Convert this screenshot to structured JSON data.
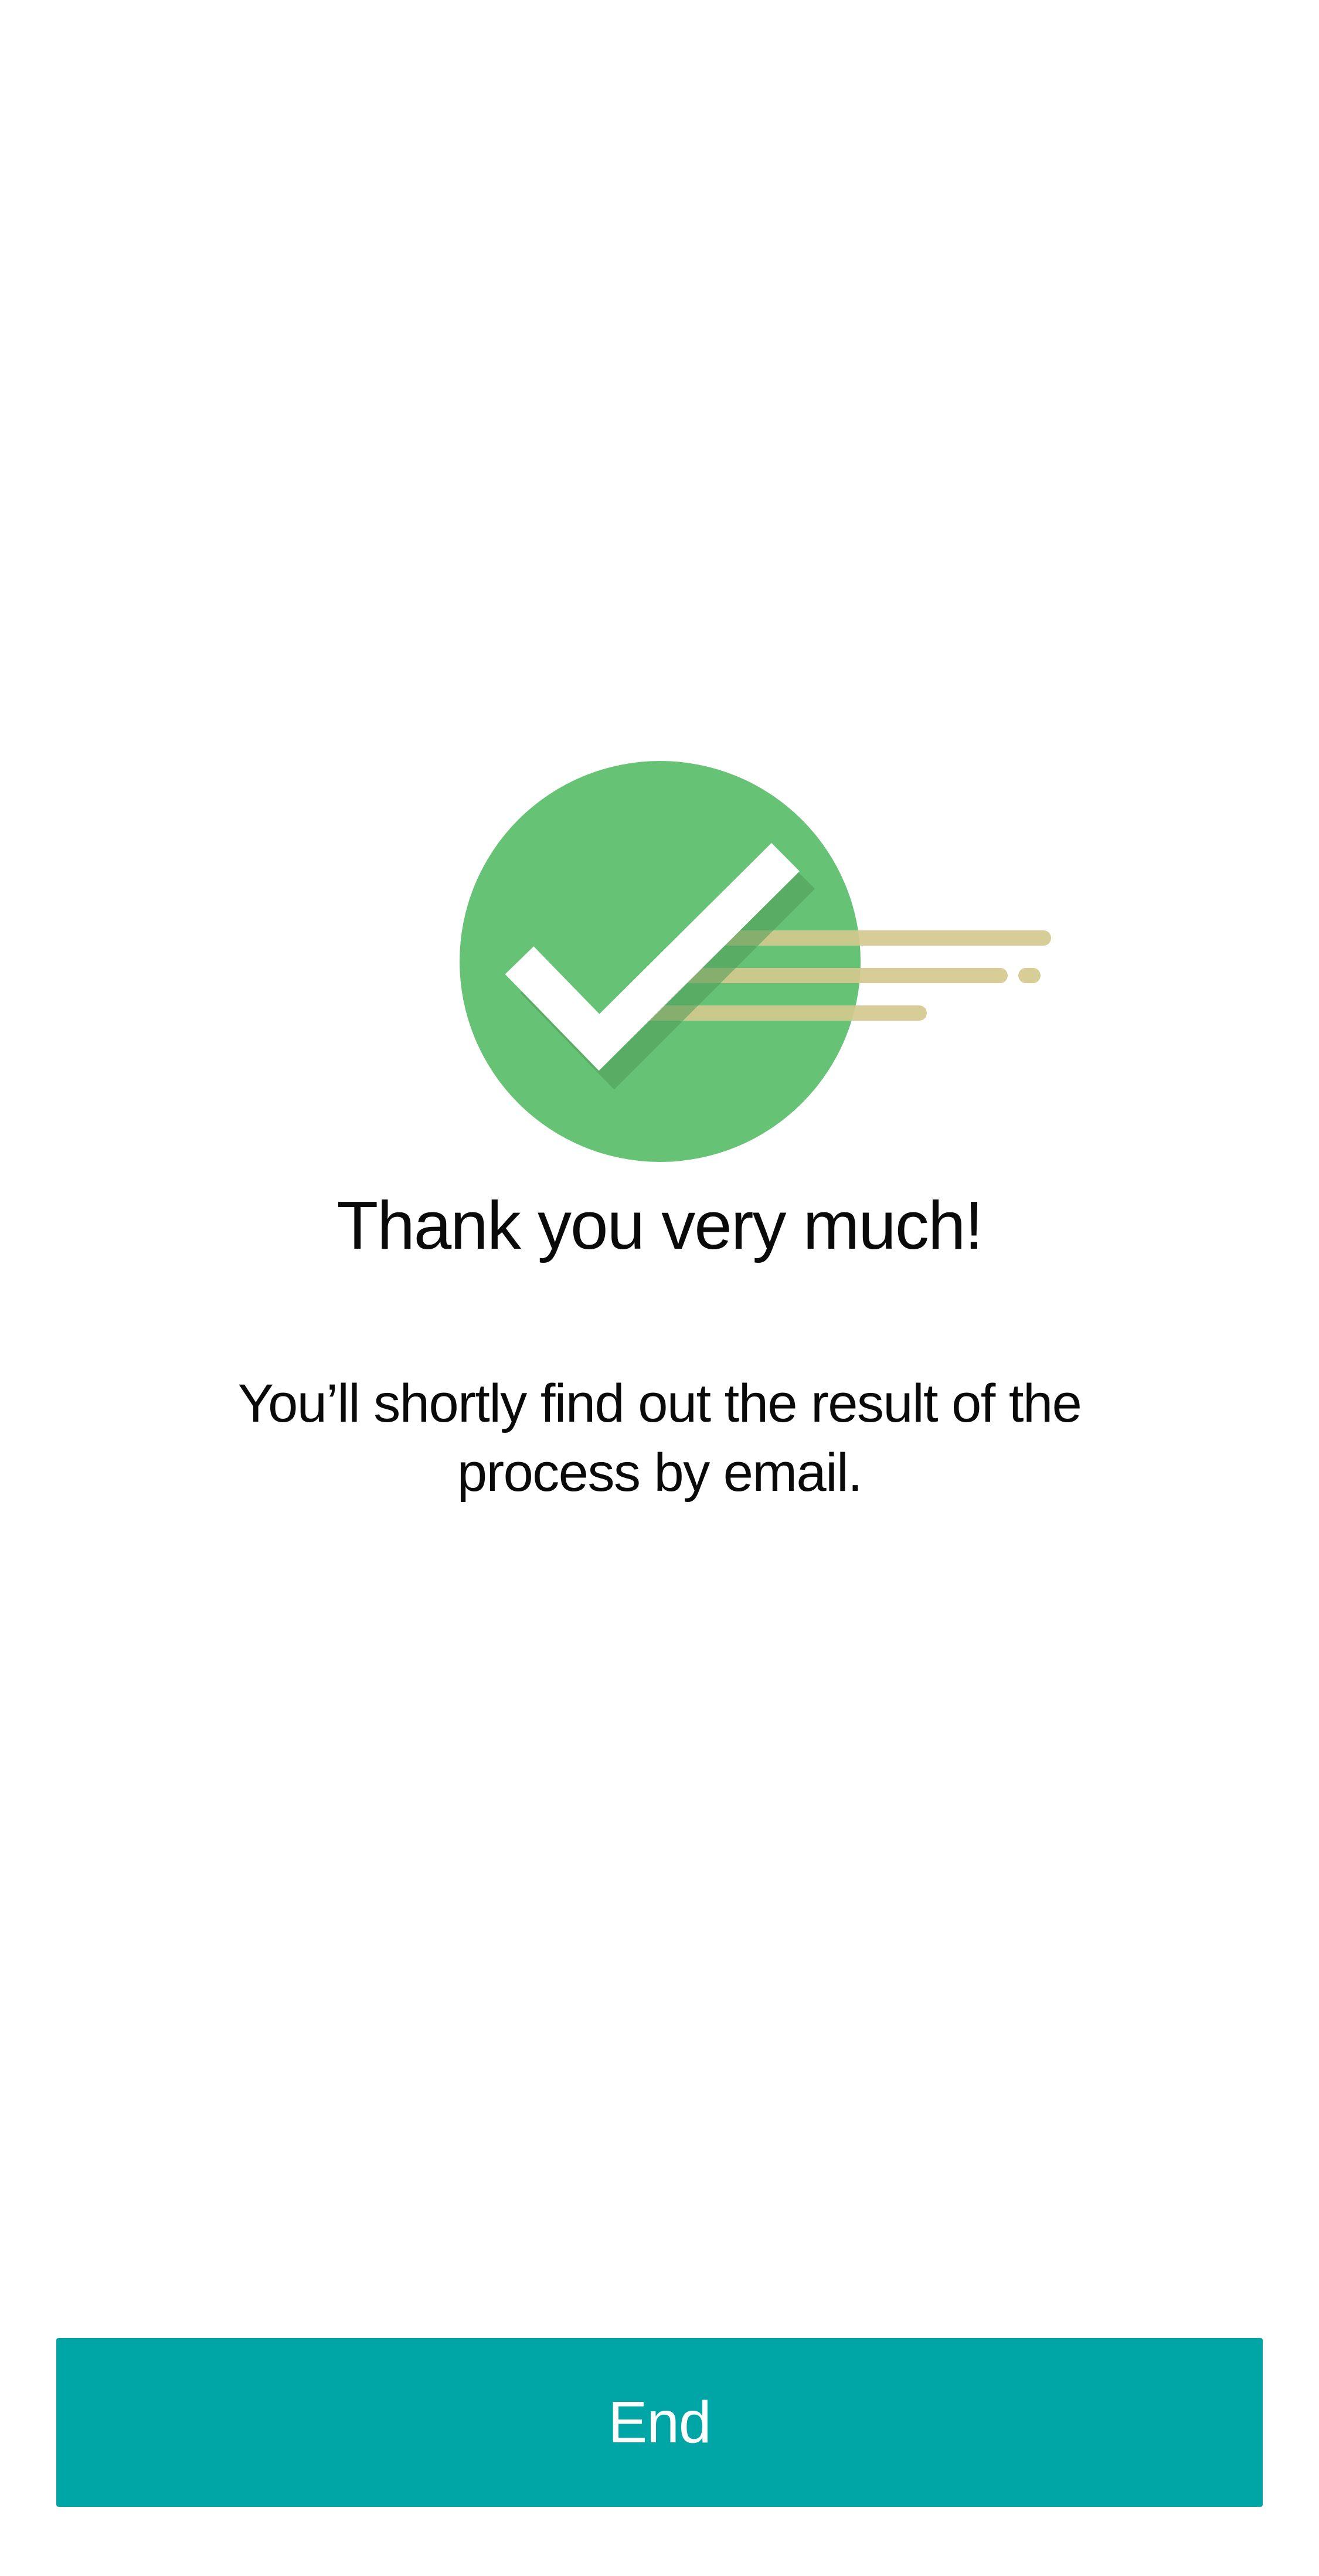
{
  "confirmation": {
    "icon": "success-check-icon",
    "title": "Thank you very much!",
    "message": "You’ll shortly find out the result of the process by email."
  },
  "actions": {
    "end_label": "End"
  },
  "colors": {
    "success_green": "#66c274",
    "speed_lines": "#d4c98f",
    "button_teal": "#00a6a6",
    "text": "#0a0a0a",
    "background": "#ffffff"
  }
}
